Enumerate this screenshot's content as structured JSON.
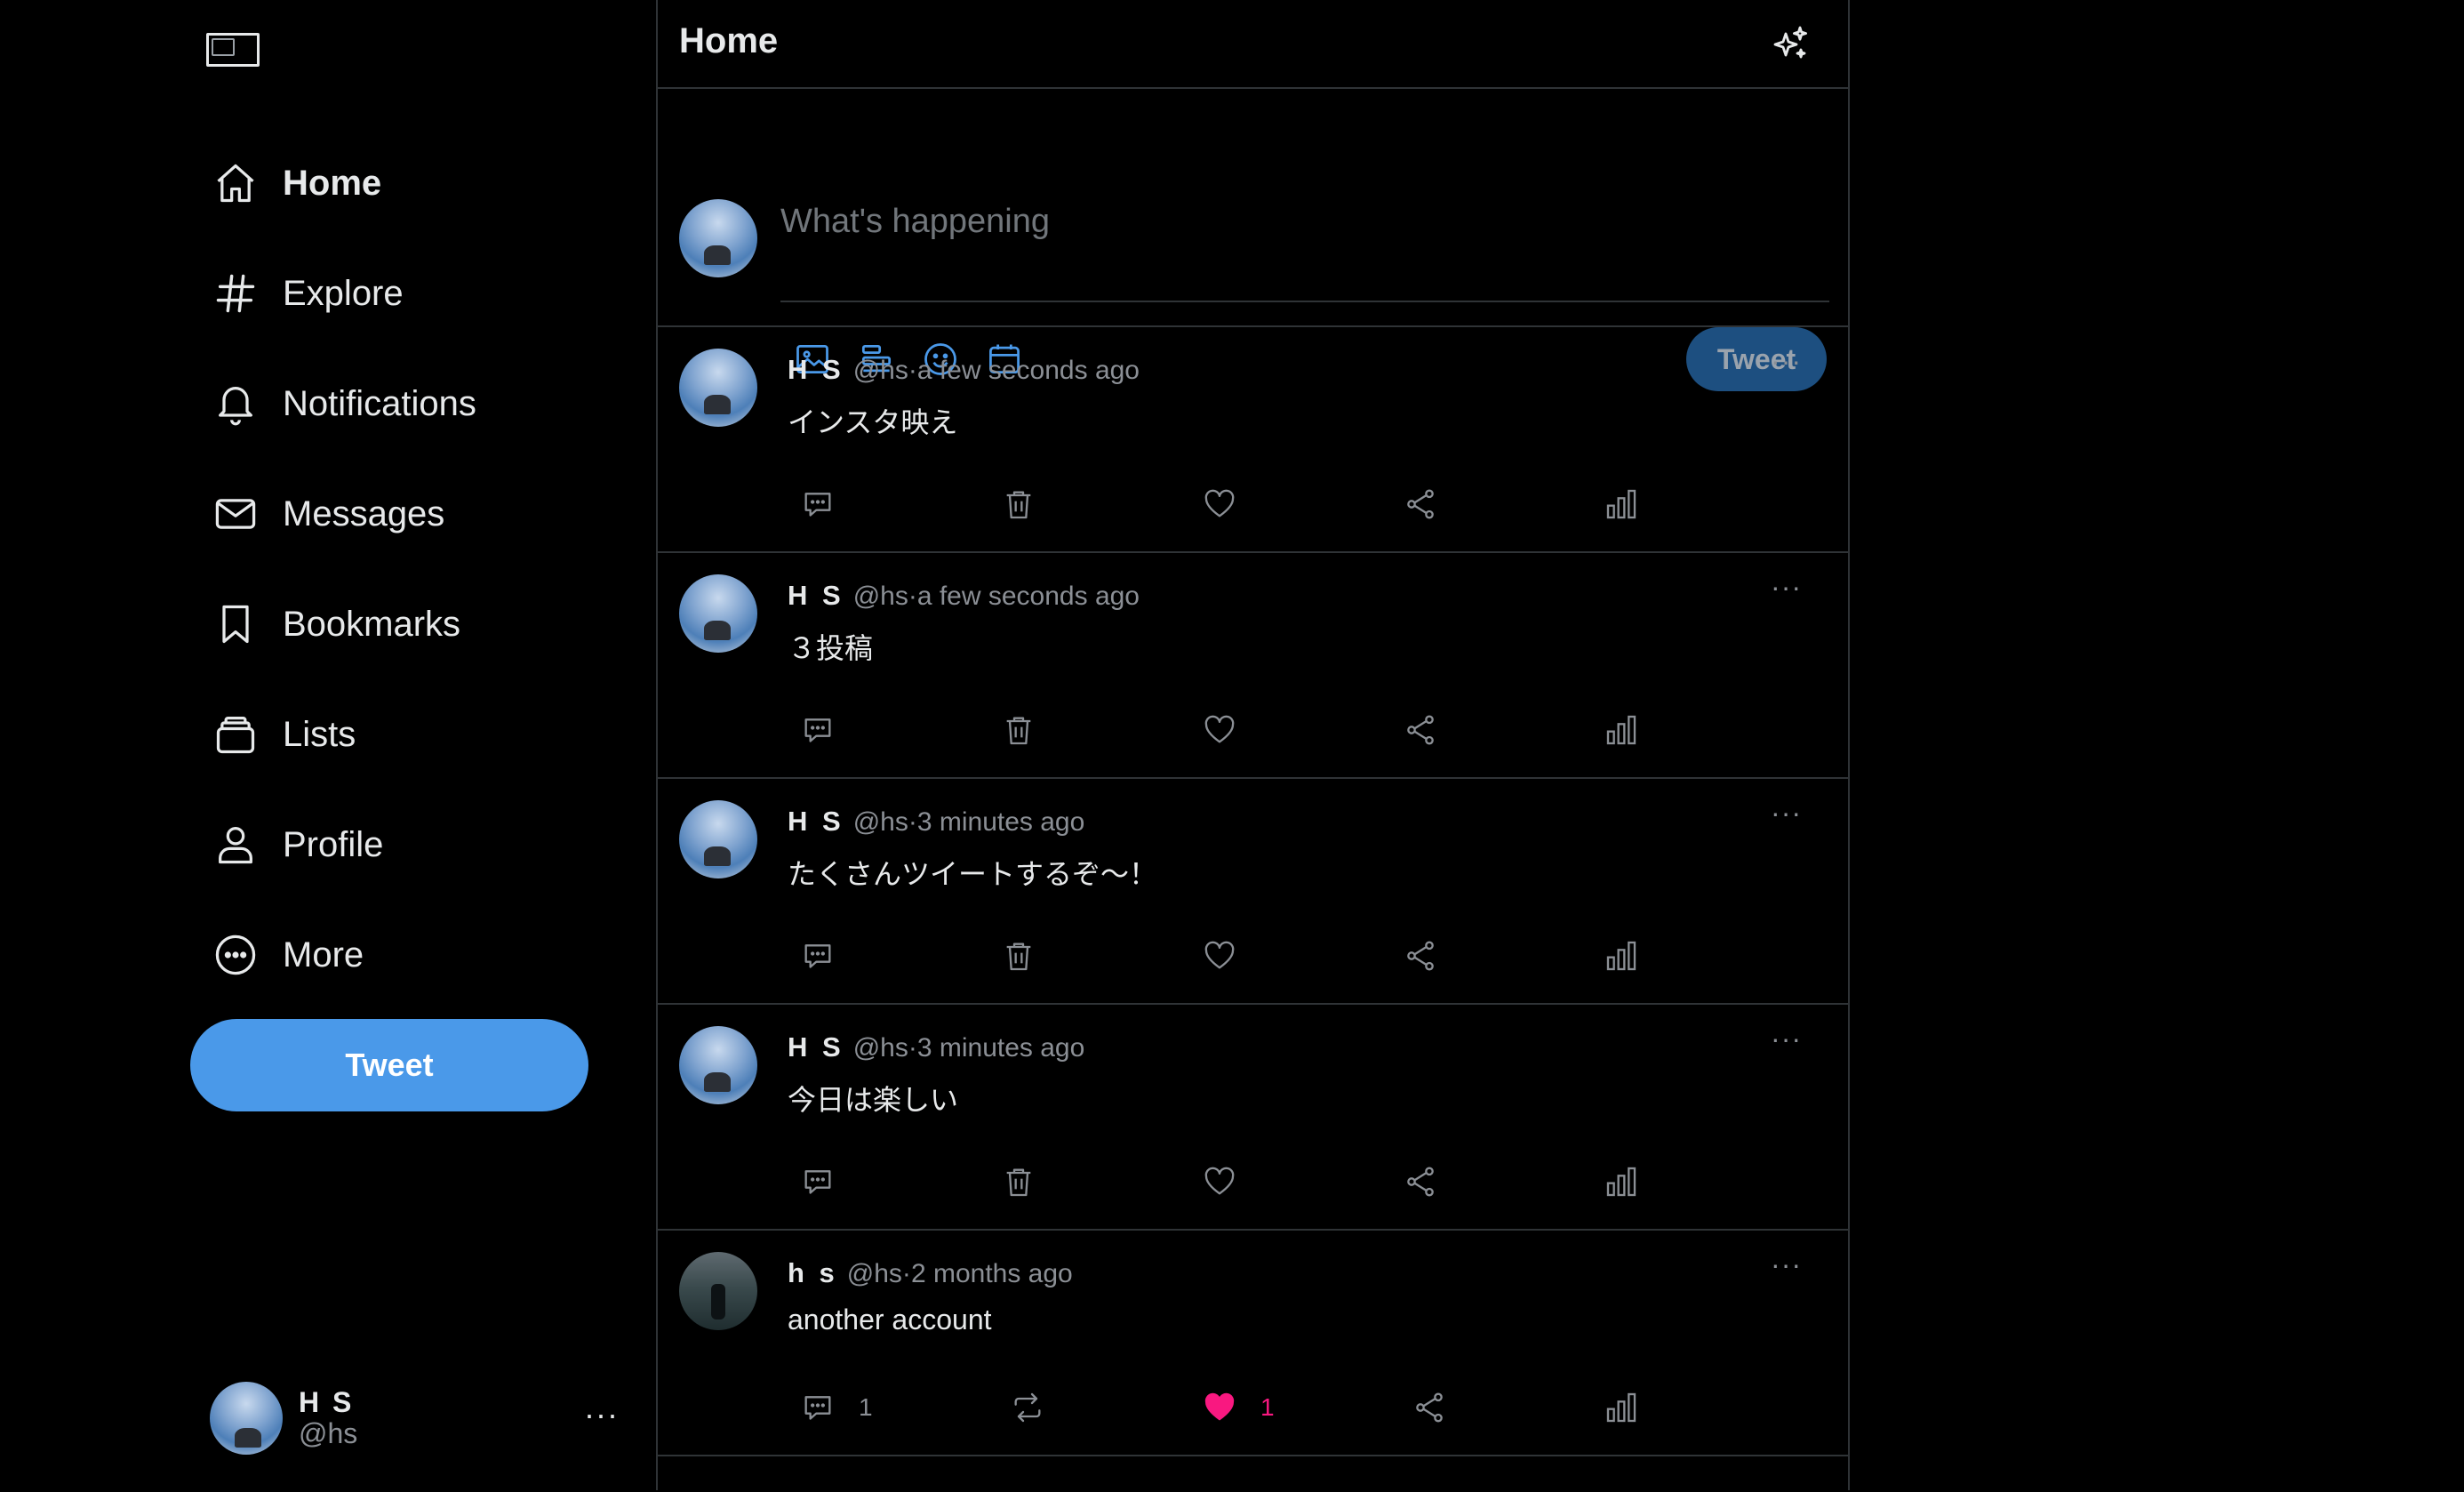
{
  "sidebar": {
    "nav": [
      {
        "label": "Home",
        "icon": "home-icon",
        "active": true
      },
      {
        "label": "Explore",
        "icon": "hashtag-icon"
      },
      {
        "label": "Notifications",
        "icon": "bell-icon"
      },
      {
        "label": "Messages",
        "icon": "mail-icon"
      },
      {
        "label": "Bookmarks",
        "icon": "bookmark-icon"
      },
      {
        "label": "Lists",
        "icon": "lists-icon"
      },
      {
        "label": "Profile",
        "icon": "user-icon"
      },
      {
        "label": "More",
        "icon": "more-circle-icon"
      }
    ],
    "tweet_button": "Tweet",
    "account": {
      "name": "H S",
      "handle": "@hs",
      "more": "···"
    }
  },
  "header": {
    "title": "Home"
  },
  "composer": {
    "placeholder": "What's happening",
    "tweet_button": "Tweet"
  },
  "tweets": [
    {
      "name": "H S",
      "handle": "@hs·",
      "time": " a few seconds ago",
      "text": "インスタ映え",
      "own": true
    },
    {
      "name": "H S",
      "handle": "@hs·",
      "time": " a few seconds ago",
      "text": "３投稿",
      "own": true
    },
    {
      "name": "H S",
      "handle": "@hs·",
      "time": " 3 minutes ago",
      "text": "たくさんツイートするぞ〜！",
      "own": true
    },
    {
      "name": "H S",
      "handle": "@hs·",
      "time": " 3 minutes ago",
      "text": "今日は楽しい",
      "own": true
    },
    {
      "name": "h s",
      "handle": "@hs·",
      "time": " 2 months ago",
      "text": "another account",
      "own": false,
      "reply_count": "1",
      "like_count": "1",
      "liked": true
    }
  ],
  "more_label": "···",
  "colors": {
    "accent": "#4a99e9",
    "like": "#f91880",
    "composer_icon": "#4a99e9"
  }
}
